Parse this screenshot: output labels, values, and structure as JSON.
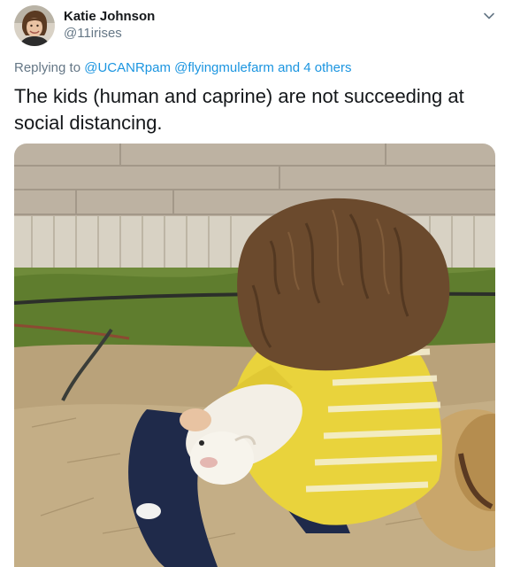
{
  "author": {
    "display_name": "Katie Johnson",
    "handle": "@11irises",
    "avatar_icon": "profile-photo"
  },
  "reply": {
    "prefix": "Replying to",
    "mention_1": "@UCANRpam",
    "mention_2": "@flyingmulefarm",
    "others": "and 4 others"
  },
  "tweet": {
    "text": "The kids (human and caprine) are not succeeding at social distancing."
  },
  "menu": {
    "icon": "chevron-down-icon"
  },
  "media": {
    "type": "photo",
    "icon": "tweet-photo"
  },
  "colors": {
    "link": "#1b95e0",
    "secondary_text": "#657786",
    "primary_text": "#14171a"
  }
}
